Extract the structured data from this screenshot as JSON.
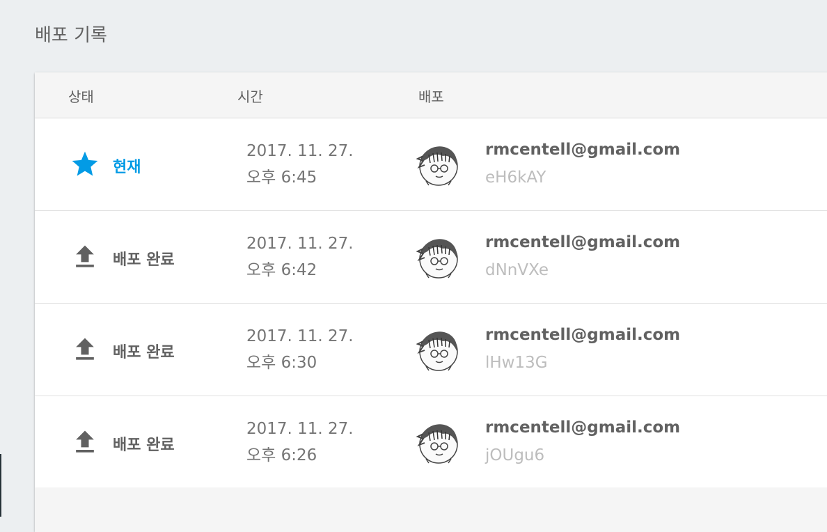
{
  "page": {
    "title": "배포 기록"
  },
  "table": {
    "headers": {
      "status": "상태",
      "time": "시간",
      "deploy": "배포"
    },
    "rows": [
      {
        "status": "현재",
        "status_icon": "star-icon",
        "date": "2017. 11. 27.",
        "clock": "오후 6:45",
        "email": "rmcentell@gmail.com",
        "release_id": "eH6kAY"
      },
      {
        "status": "배포 완료",
        "status_icon": "upload-icon",
        "date": "2017. 11. 27.",
        "clock": "오후 6:42",
        "email": "rmcentell@gmail.com",
        "release_id": "dNnVXe"
      },
      {
        "status": "배포 완료",
        "status_icon": "upload-icon",
        "date": "2017. 11. 27.",
        "clock": "오후 6:30",
        "email": "rmcentell@gmail.com",
        "release_id": "lHw13G"
      },
      {
        "status": "배포 완료",
        "status_icon": "upload-icon",
        "date": "2017. 11. 27.",
        "clock": "오후 6:26",
        "email": "rmcentell@gmail.com",
        "release_id": "jOUgu6"
      }
    ]
  },
  "colors": {
    "current": "#039be5",
    "deployed": "#616161",
    "background": "#eceff1"
  }
}
